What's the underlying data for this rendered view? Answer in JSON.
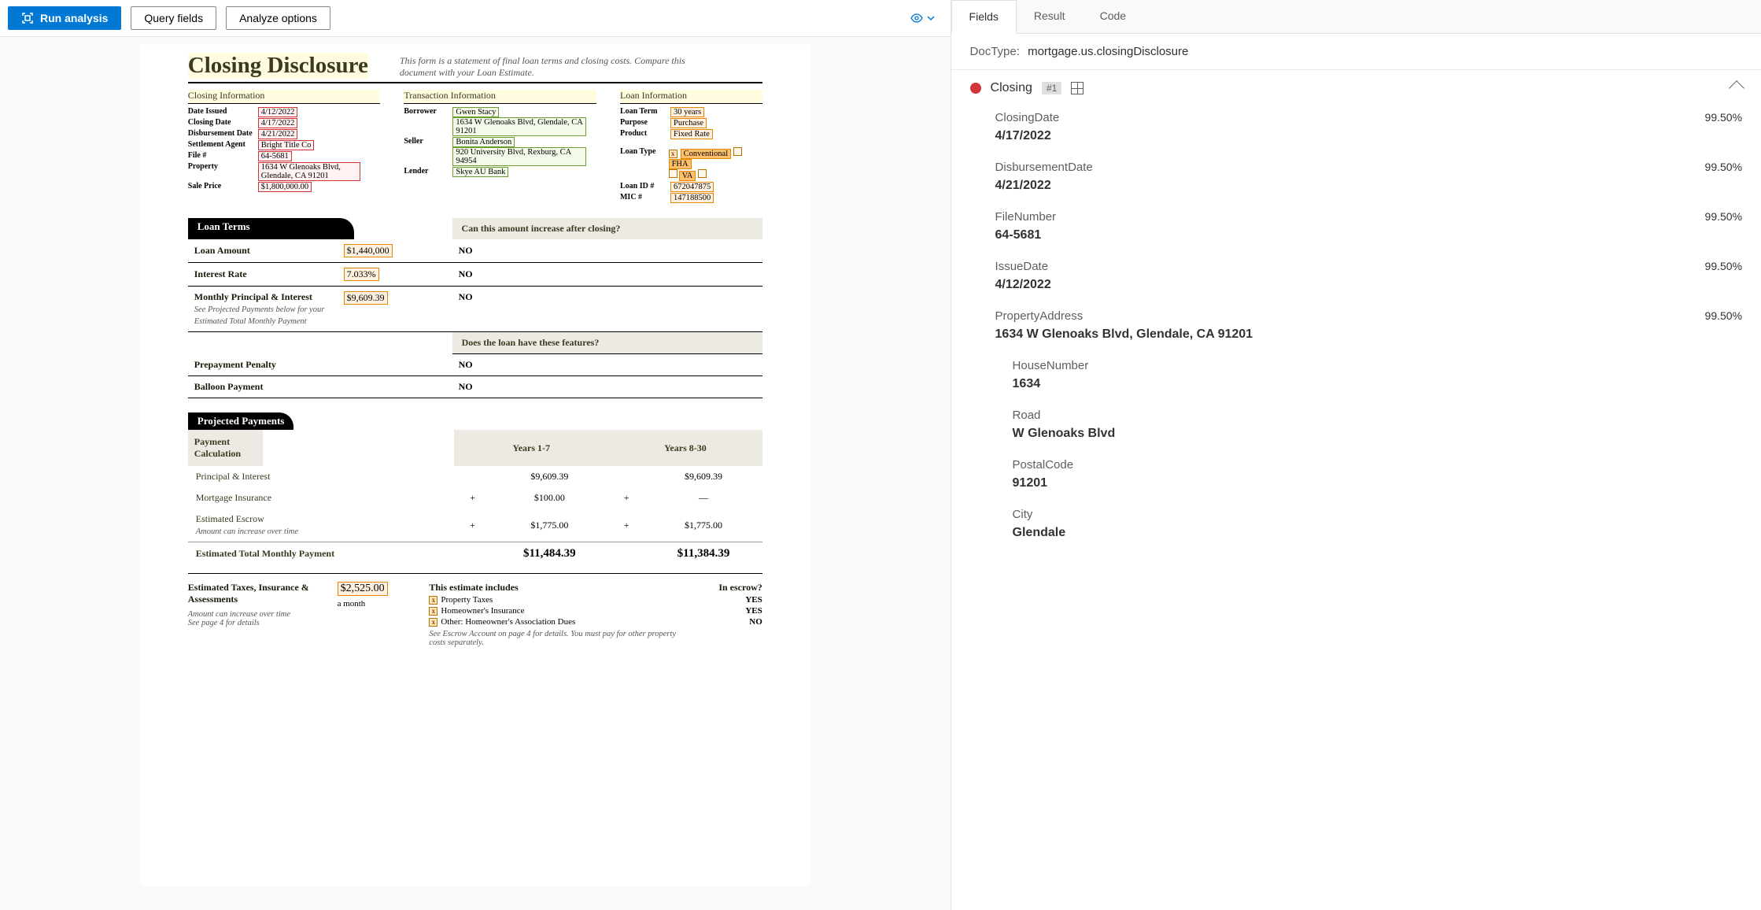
{
  "toolbar": {
    "run_analysis": "Run analysis",
    "query_fields": "Query fields",
    "analyze_options": "Analyze options"
  },
  "document": {
    "title": "Closing Disclosure",
    "subtitle": "This form is a statement of final loan terms and closing costs. Compare this document with your Loan Estimate.",
    "closing_info_header": "Closing  Information",
    "transaction_info_header": "Transaction  Information",
    "loan_info_header": "Loan  Information",
    "closing_info": {
      "date_issued_label": "Date Issued",
      "date_issued": "4/12/2022",
      "closing_date_label": "Closing Date",
      "closing_date": "4/17/2022",
      "disbursement_date_label": "Disbursement Date",
      "disbursement_date": "4/21/2022",
      "settlement_agent_label": "Settlement Agent",
      "settlement_agent": "Bright Title Co",
      "file_no_label": "File #",
      "file_no": "64-5681",
      "property_label": "Property",
      "property": "1634 W Glenoaks Blvd, Glendale, CA 91201",
      "sale_price_label": "Sale Price",
      "sale_price": "$1,800,000.00"
    },
    "transaction_info": {
      "borrower_label": "Borrower",
      "borrower_name": "Gwen Stacy",
      "borrower_addr": "1634 W Glenoaks Blvd, Glendale, CA 91201",
      "seller_label": "Seller",
      "seller_name": "Bonita Anderson",
      "seller_addr": "920 University Blvd, Rexburg, CA 94954",
      "lender_label": "Lender",
      "lender": "Skye AU Bank"
    },
    "loan_info": {
      "loan_term_label": "Loan Term",
      "loan_term": "30 years",
      "purpose_label": "Purpose",
      "purpose": "Purchase",
      "product_label": "Product",
      "product": "Fixed Rate",
      "loan_type_label": "Loan Type",
      "loan_type_conventional": "Conventional",
      "loan_type_fha": "FHA",
      "loan_type_va": "VA",
      "loan_id_label": "Loan ID #",
      "loan_id": "672047875",
      "mic_label": "MIC #",
      "mic": "147188500"
    },
    "loan_terms_header": "Loan Terms",
    "loan_terms_q": "Can this amount increase after closing?",
    "loan_amount_label": "Loan Amount",
    "loan_amount": "$1,440,000",
    "loan_amount_inc": "NO",
    "interest_rate_label": "Interest Rate",
    "interest_rate": "7.033%",
    "interest_rate_inc": "NO",
    "mpi_label": "Monthly Principal & Interest",
    "mpi_note": "See Projected Payments below for your Estimated Total Monthly Payment",
    "mpi": "$9,609.39",
    "mpi_inc": "NO",
    "features_q": "Does the loan have these features?",
    "prepayment_label": "Prepayment Penalty",
    "prepayment": "NO",
    "balloon_label": "Balloon Payment",
    "balloon": "NO",
    "projected_header": "Projected Payments",
    "payment_calc": "Payment Calculation",
    "years17": "Years 1-7",
    "years830": "Years 8-30",
    "pi_label": "Principal & Interest",
    "pi1": "$9,609.39",
    "pi2": "$9,609.39",
    "mi_label": "Mortgage Insurance",
    "mi1": "$100.00",
    "mi2": "—",
    "ee_label": "Estimated Escrow",
    "ee_note": "Amount can increase over time",
    "ee1": "$1,775.00",
    "ee2": "$1,775.00",
    "etmp_label": "Estimated Total Monthly Payment",
    "etmp1": "$11,484.39",
    "etmp2": "$11,384.39",
    "etia_label": "Estimated Taxes, Insurance & Assessments",
    "etia_note1": "Amount can increase over time",
    "etia_note2": "See page 4 for details",
    "etia_amount": "$2,525.00",
    "etia_per": "a month",
    "includes_label": "This estimate includes",
    "in_escrow_label": "In escrow?",
    "inc_prop_tax": "Property Taxes",
    "inc_prop_tax_esc": "YES",
    "inc_home_ins": "Homeowner's Insurance",
    "inc_home_ins_esc": "YES",
    "inc_other": "Other: Homeowner's Association Dues",
    "inc_other_esc": "NO",
    "escrow_footer": "See Escrow Account on page 4 for details. You must pay for other property costs separately."
  },
  "panel": {
    "tabs": {
      "fields": "Fields",
      "result": "Result",
      "code": "Code"
    },
    "doctype_label": "DocType:",
    "doctype_value": "mortgage.us.closingDisclosure",
    "group_name": "Closing",
    "group_badge": "#1",
    "fields": [
      {
        "name": "ClosingDate",
        "conf": "99.50%",
        "value": "4/17/2022"
      },
      {
        "name": "DisbursementDate",
        "conf": "99.50%",
        "value": "4/21/2022"
      },
      {
        "name": "FileNumber",
        "conf": "99.50%",
        "value": "64-5681"
      },
      {
        "name": "IssueDate",
        "conf": "99.50%",
        "value": "4/12/2022"
      },
      {
        "name": "PropertyAddress",
        "conf": "99.50%",
        "value": "1634 W Glenoaks Blvd, Glendale, CA 91201"
      }
    ],
    "subfields": [
      {
        "name": "HouseNumber",
        "value": "1634"
      },
      {
        "name": "Road",
        "value": "W Glenoaks Blvd"
      },
      {
        "name": "PostalCode",
        "value": "91201"
      },
      {
        "name": "City",
        "value": "Glendale"
      }
    ]
  }
}
